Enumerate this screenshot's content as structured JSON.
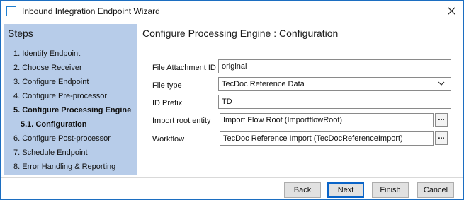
{
  "window": {
    "title": "Inbound Integration Endpoint Wizard",
    "accent_color": "#1c6ec1"
  },
  "steps": {
    "title": "Steps",
    "background": "#b7cce9",
    "items": [
      {
        "label": "1. Identify Endpoint",
        "current": false
      },
      {
        "label": "2. Choose Receiver",
        "current": false
      },
      {
        "label": "3. Configure Endpoint",
        "current": false
      },
      {
        "label": "4. Configure Pre-processor",
        "current": false
      },
      {
        "label": "5. Configure Processing Engine",
        "current": true
      },
      {
        "label": "5.1. Configuration",
        "current": true
      },
      {
        "label": "6. Configure Post-processor",
        "current": false
      },
      {
        "label": "7. Schedule Endpoint",
        "current": false
      },
      {
        "label": "8. Error Handling & Reporting",
        "current": false
      }
    ]
  },
  "content": {
    "title": "Configure Processing Engine : Configuration",
    "fields": {
      "file_attachment_id": {
        "label": "File Attachment ID",
        "value": "original"
      },
      "file_type": {
        "label": "File type",
        "value": "TecDoc Reference Data"
      },
      "id_prefix": {
        "label": "ID Prefix",
        "value": "TD"
      },
      "import_root_entity": {
        "label": "Import root entity",
        "value": "Import Flow Root (ImportflowRoot)",
        "browse_label": "..."
      },
      "workflow": {
        "label": "Workflow",
        "value": "TecDoc Reference Import (TecDocReferenceImport)",
        "browse_label": "..."
      }
    }
  },
  "footer": {
    "back_label": "Back",
    "next_label": "Next",
    "finish_label": "Finish",
    "cancel_label": "Cancel"
  },
  "icons": {
    "window": "window-app-icon",
    "close": "close-icon",
    "dropdown": "chevron-down-icon"
  }
}
